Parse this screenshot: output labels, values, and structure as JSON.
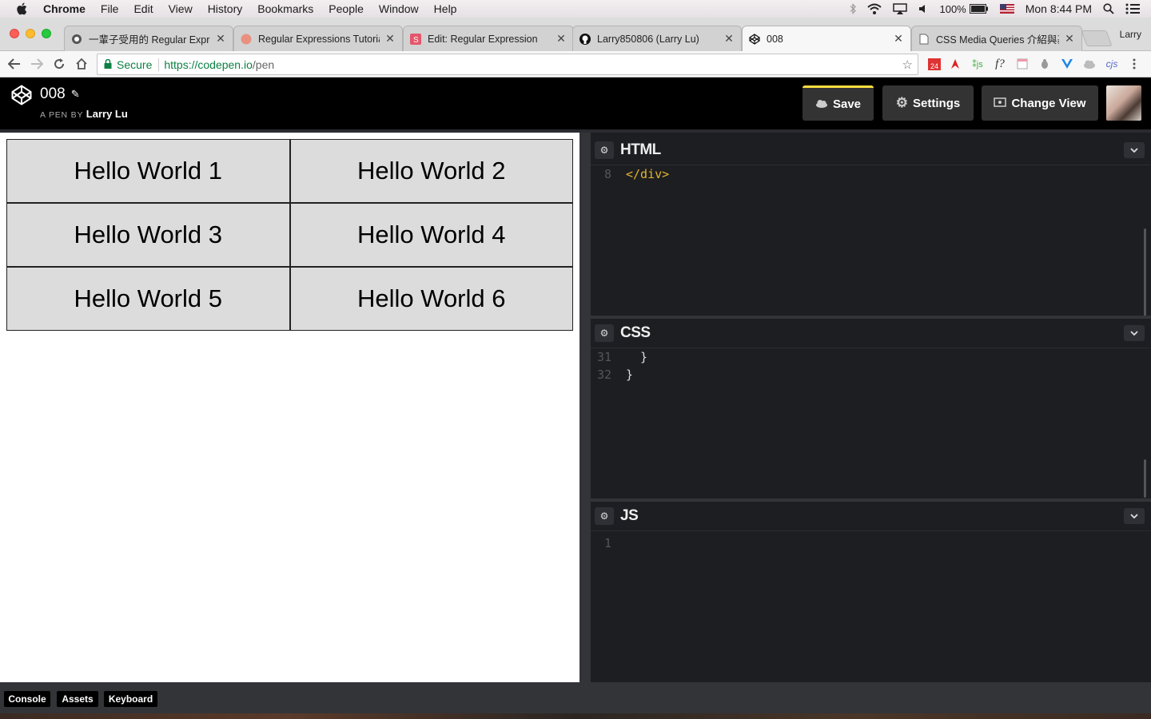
{
  "menubar": {
    "items": [
      "Chrome",
      "File",
      "Edit",
      "View",
      "History",
      "Bookmarks",
      "People",
      "Window",
      "Help"
    ],
    "battery": "100%",
    "clock": "Mon 8:44 PM"
  },
  "tabs": [
    {
      "label": "一輩子受用的 Regular Expre"
    },
    {
      "label": "Regular Expressions Tutoria"
    },
    {
      "label": "Edit: Regular Expression"
    },
    {
      "label": "Larry850806 (Larry Lu)"
    },
    {
      "label": "008"
    },
    {
      "label": "CSS Media Queries 介紹與基"
    }
  ],
  "profile_name": "Larry",
  "address": {
    "secure_label": "Secure",
    "url_host": "https://codepen.io",
    "url_path": "/pen"
  },
  "header": {
    "pen_title": "008",
    "by_prefix": "A PEN BY",
    "author": "Larry Lu",
    "save_label": "Save",
    "settings_label": "Settings",
    "change_view_label": "Change View"
  },
  "preview": {
    "cells": [
      "Hello World 1",
      "Hello World 2",
      "Hello World 3",
      "Hello World 4",
      "Hello World 5",
      "Hello World 6"
    ]
  },
  "editors": {
    "html": {
      "title": "HTML",
      "lines": [
        {
          "num": "8",
          "text": "</div>"
        }
      ]
    },
    "css": {
      "title": "CSS",
      "lines": [
        {
          "num": "31",
          "text": "  }"
        },
        {
          "num": "32",
          "text": "}"
        }
      ]
    },
    "js": {
      "title": "JS",
      "lines": [
        {
          "num": "1",
          "text": ""
        }
      ]
    }
  },
  "bottombar": {
    "console_label": "Console",
    "assets_label": "Assets",
    "keyboard_label": "Keyboard"
  },
  "colors": {
    "save_accent": "#ffdd40",
    "secure_green": "#0b8043",
    "html_tag": "#e2b52a"
  }
}
